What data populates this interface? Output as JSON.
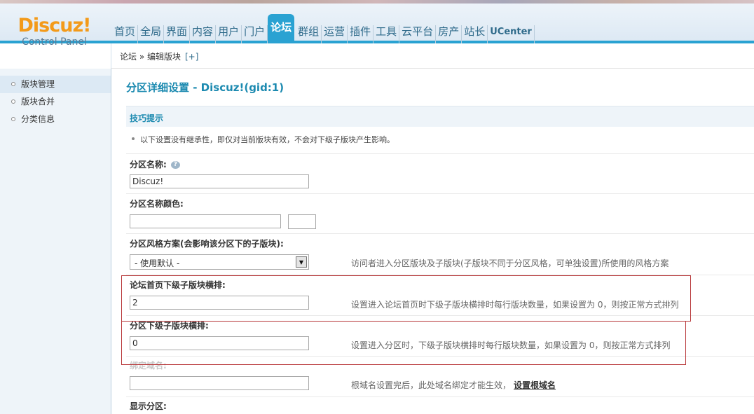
{
  "logo": {
    "main": "Discuz!",
    "sub": "Control Panel"
  },
  "nav": {
    "items": [
      "首页",
      "全局",
      "界面",
      "内容",
      "用户",
      "门户",
      "论坛",
      "群组",
      "运营",
      "插件",
      "工具",
      "云平台",
      "房产",
      "站长",
      "UCenter"
    ],
    "active_index": 6
  },
  "breadcrumb": {
    "path": "论坛 » 编辑版块",
    "add": "[+]"
  },
  "sidebar": {
    "items": [
      "版块管理",
      "版块合并",
      "分类信息"
    ],
    "active_index": 0
  },
  "page": {
    "title": "分区详细设置 - Discuz!(gid:1)",
    "tips_title": "技巧提示",
    "tip": "以下设置没有继承性，即仅对当前版块有效，不会对下级子版块产生影响。"
  },
  "form": {
    "name": {
      "label": "分区名称:",
      "value": "Discuz!",
      "help_icon": "?"
    },
    "color": {
      "label": "分区名称颜色:",
      "value": ""
    },
    "style": {
      "label": "分区风格方案(会影响该分区下的子版块):",
      "value": "- 使用默认 -",
      "hint": "访问者进入分区版块及子版块(子版块不同于分区风格，可单独设置)所使用的风格方案"
    },
    "index_columns": {
      "label": "论坛首页下级子版块横排:",
      "value": "2",
      "hint": "设置进入论坛首页时下级子版块横排时每行版块数量，如果设置为 0，则按正常方式排列"
    },
    "sub_columns": {
      "label": "分区下级子版块横排:",
      "value": "0",
      "hint": "设置进入分区时，下级子版块横排时每行版块数量，如果设置为 0，则按正常方式排列"
    },
    "domain": {
      "label": "绑定域名:",
      "value": "",
      "hint": "根域名设置完后，此处域名绑定才能生效，",
      "link": "设置根域名"
    },
    "show": {
      "label": "显示分区:"
    }
  },
  "colors": {
    "accent": "#2aa2d2",
    "title": "#1c8ab0",
    "highlight_border": "#b8383a",
    "logo": "#f39a1a"
  }
}
